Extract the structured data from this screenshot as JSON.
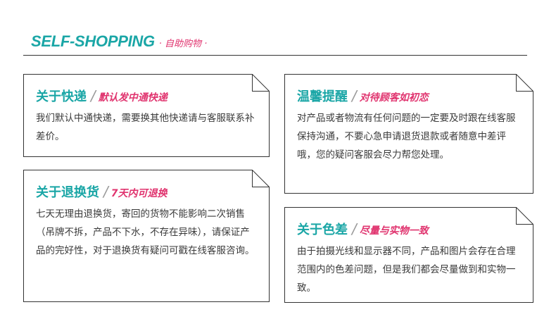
{
  "header": {
    "brand": "SELF-SHOPPING",
    "subtitle": "· 自助购物 ·",
    "brand_color": "#1aa6a6",
    "subtitle_color": "#e0336e"
  },
  "colors": {
    "title_teal": "#1aa6a6",
    "title_pink": "#e0336e",
    "border": "#333333",
    "slash": "#9a9a9a"
  },
  "cards": [
    {
      "title": "关于快递",
      "subtitle": "默认发中通快递",
      "body": "我们默认中通快递，需要换其他快递请与客服联系补差价。"
    },
    {
      "title": "关于退换货",
      "subtitle": "7天内可退换",
      "body": "七天无理由退换货，寄回的货物不能影响二次销售（吊牌不拆，产品不下水，不存在异味），请保证产品的完好性，对于退换货有疑问可戳在线客服咨询。"
    },
    {
      "title": "温馨提醒",
      "subtitle": "对待顾客如初恋",
      "body": "对产品或者物流有任何问题的一定要及时跟在线客服保持沟通，不要心急申请退货退款或者随意中差评哦，您的疑问客服会尽力帮您处理。"
    },
    {
      "title": "关于色差",
      "subtitle": "尽量与实物一致",
      "body": "由于拍摄光线和显示器不同，产品和图片会存在合理范围内的色差问题，但是我们都会尽量做到和实物一致。"
    }
  ]
}
